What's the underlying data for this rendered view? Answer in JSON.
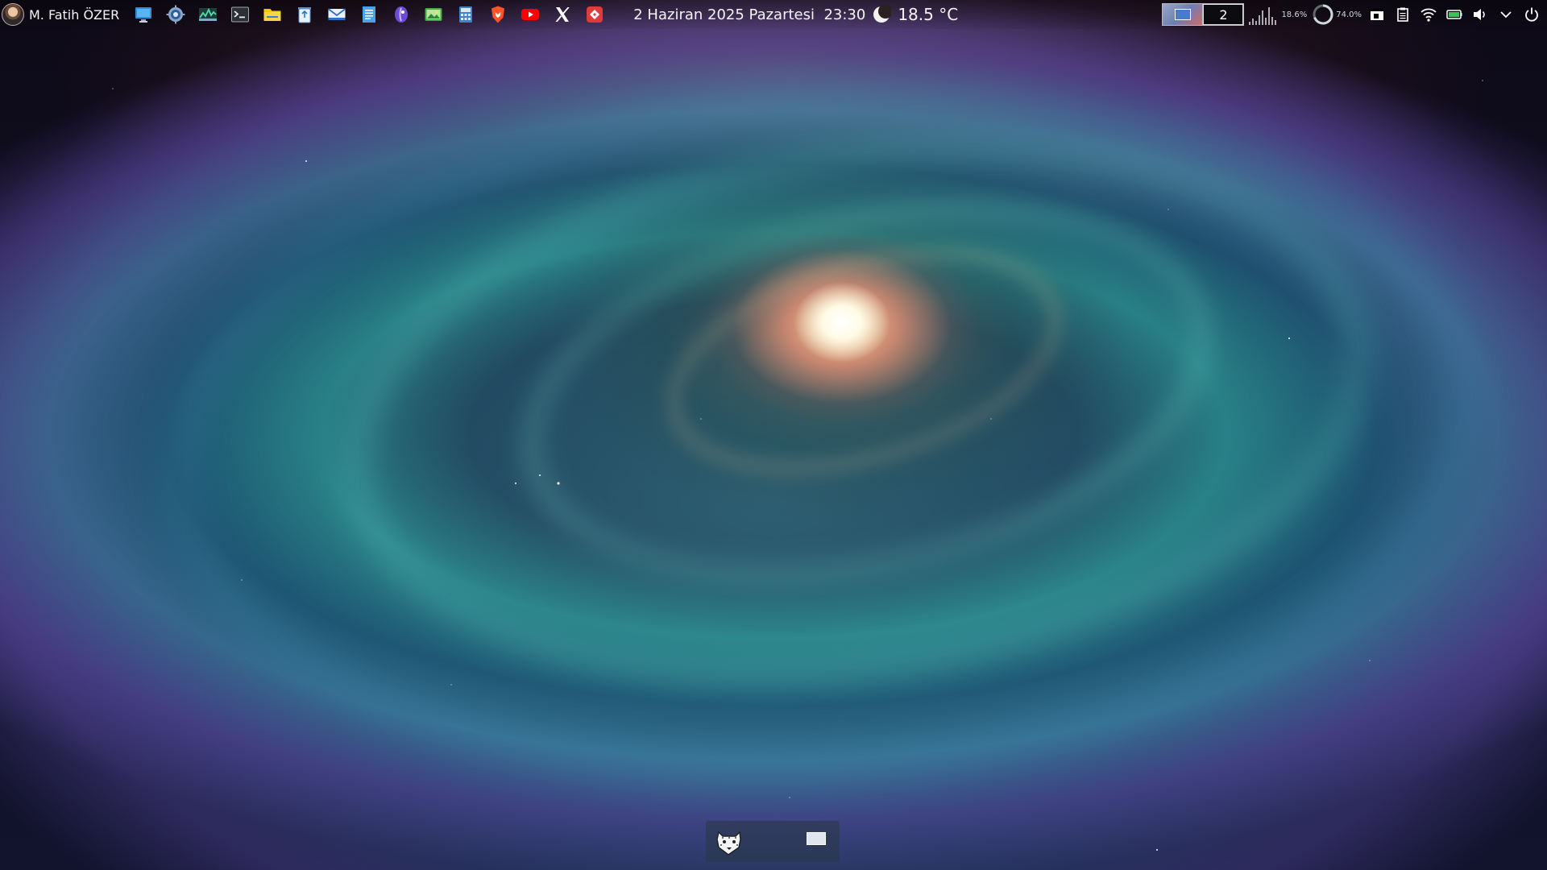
{
  "user": {
    "name": "M. Fatih ÖZER"
  },
  "launchers": [
    {
      "name": "desktop-icon"
    },
    {
      "name": "settings-gear-icon"
    },
    {
      "name": "system-monitor-icon"
    },
    {
      "name": "terminal-icon"
    },
    {
      "name": "file-manager-folder-icon"
    },
    {
      "name": "recycle-bin-icon"
    },
    {
      "name": "mail-icon"
    },
    {
      "name": "text-editor-icon"
    },
    {
      "name": "purple-app-icon"
    },
    {
      "name": "image-viewer-icon"
    },
    {
      "name": "calculator-icon"
    },
    {
      "name": "brave-browser-icon"
    },
    {
      "name": "youtube-icon"
    },
    {
      "name": "x-twitter-icon"
    },
    {
      "name": "red-app-icon"
    }
  ],
  "clock": {
    "datetime": "2 Haziran 2025 Pazartesi  23:30"
  },
  "weather": {
    "icon": "moon-icon",
    "temperature": "18.5 °C"
  },
  "tray": {
    "pager": {
      "current_desktop": "2"
    },
    "cpu_usage": "18.6%",
    "gauge_value": "74.0%",
    "icons": [
      "window-manager-icon",
      "clipboard-icon",
      "wifi-icon",
      "battery-icon",
      "volume-icon",
      "chevron-down-icon",
      "power-icon"
    ]
  },
  "colors": {
    "youtube": "#ff0000",
    "brave": "#fb542b",
    "folder": "#f5c518",
    "red_app": "#e03a3a"
  }
}
